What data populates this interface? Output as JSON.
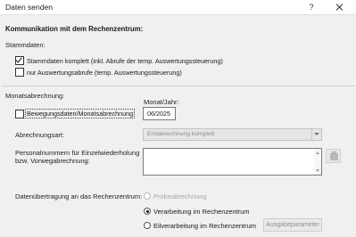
{
  "window": {
    "title": "Daten senden",
    "help_glyph": "?"
  },
  "heading": "Kommunikation mit dem Rechenzentrum:",
  "stammdaten": {
    "label": "Stammdaten:",
    "options": [
      {
        "label": "Stammdaten komplett (inkl. Abrufe der temp. Auswertungssteuerung)",
        "checked": true
      },
      {
        "label": "nur Auswertungsabrufe (temp. Auswertungssteuerung)",
        "checked": false
      }
    ]
  },
  "monatsabrechnung": {
    "label": "Monatsabrechnung:",
    "bewegungsdaten": {
      "label": "Bewegungsdaten/Monatsabrechnung",
      "checked": false
    },
    "monat_jahr": {
      "label": "Monat/Jahr:",
      "value": "06/2025"
    },
    "abrechnungsart": {
      "label": "Abrechnungsart:",
      "value": "Erstabrechnung komplett",
      "enabled": false
    },
    "personalnummern": {
      "label_line1": "Personalnummern für Einzelwiederholung",
      "label_line2": "bzw. Vorwegabrechnung:",
      "value": ""
    }
  },
  "datenuebertragung": {
    "label": "Datenübertragung an das Rechenzentrum:",
    "options": [
      {
        "label": "Probeabrechnung",
        "selected": false,
        "enabled": false
      },
      {
        "label": "Verarbeitung im Rechenzentrum",
        "selected": true,
        "enabled": true
      },
      {
        "label": "Eilverarbeitung im Rechenzentrum",
        "selected": false,
        "enabled": true
      }
    ],
    "ausgabeparameter_label": "Ausgabeparameter"
  },
  "icons": {
    "close": "close-icon",
    "checkmark": "checkmark-icon",
    "dropdown": "chevron-down-icon",
    "side_button": "clipboard-icon"
  }
}
